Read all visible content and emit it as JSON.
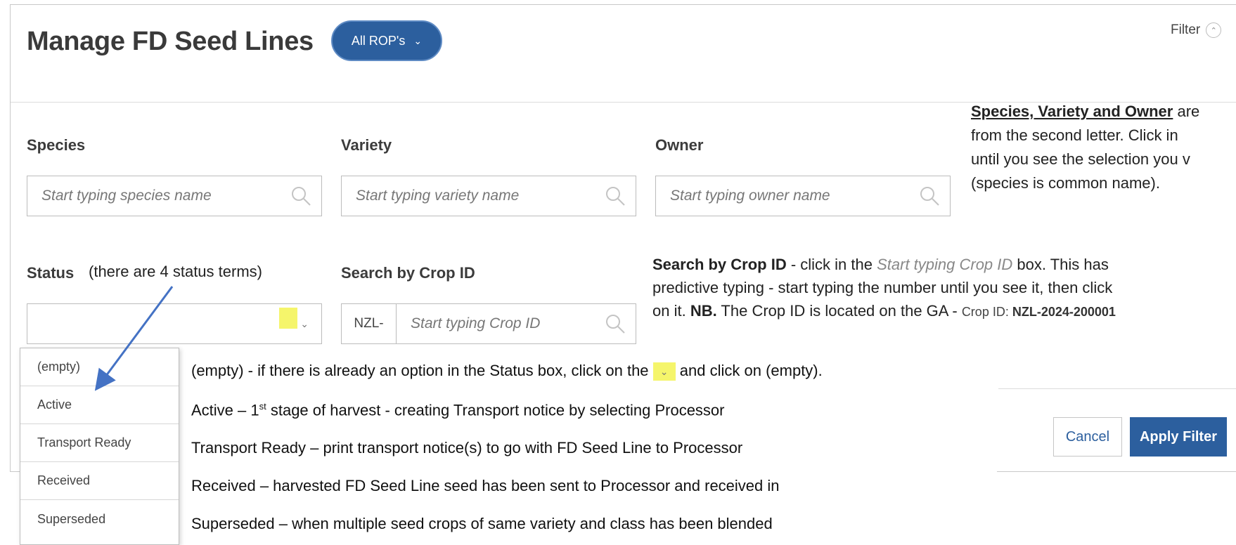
{
  "header": {
    "title": "Manage FD Seed Lines",
    "rop_button": "All ROP's",
    "filter_label": "Filter"
  },
  "fields": {
    "species": {
      "label": "Species",
      "placeholder": "Start typing species name"
    },
    "variety": {
      "label": "Variety",
      "placeholder": "Start typing variety name"
    },
    "owner": {
      "label": "Owner",
      "placeholder": "Start typing owner name"
    },
    "status": {
      "label": "Status",
      "note": "(there are 4 status terms)"
    },
    "crop_id": {
      "label": "Search by Crop ID",
      "prefix": "NZL-",
      "placeholder": "Start typing Crop ID"
    }
  },
  "annotations": {
    "search_bold": "Species, Variety and Owner",
    "search_line1_rest": " are",
    "search_line2": "from the second letter.  Click in",
    "search_line3": "until you see the selection you v",
    "search_line4": "(species is common name).",
    "crop_bold": "Search by Crop ID",
    "crop_text1": " - click in the ",
    "crop_italic": "Start typing Crop ID",
    "crop_text2": " box. This has",
    "crop_line2": "predictive typing - start typing the number until you see it, then click",
    "crop_line3_a": "on it.   ",
    "crop_nb": "NB.",
    "crop_line3_b": " The Crop ID is located on the GA - ",
    "crop_id_label": "Crop ID: ",
    "crop_id_value": "NZL-2024-200001"
  },
  "status_options": [
    "(empty)",
    "Active",
    "Transport Ready",
    "Received",
    "Superseded"
  ],
  "descriptions": {
    "empty_a": "(empty) - if there is already an option in the Status box, click on the ",
    "empty_b": " and click on (empty).",
    "active_a": "Active – 1",
    "active_sup": "st",
    "active_b": " stage of harvest - creating Transport notice by selecting Processor",
    "transport": "Transport Ready – print transport notice(s) to go with FD Seed Line to Processor",
    "received": "Received – harvested FD Seed Line seed has been sent to Processor and received in",
    "superseded": "Superseded – when multiple seed crops of same variety and class has been blended"
  },
  "buttons": {
    "cancel": "Cancel",
    "apply": "Apply Filter"
  },
  "colors": {
    "accent": "#2c5f9e",
    "highlight": "#f5f56b",
    "arrow": "#4472c4"
  }
}
